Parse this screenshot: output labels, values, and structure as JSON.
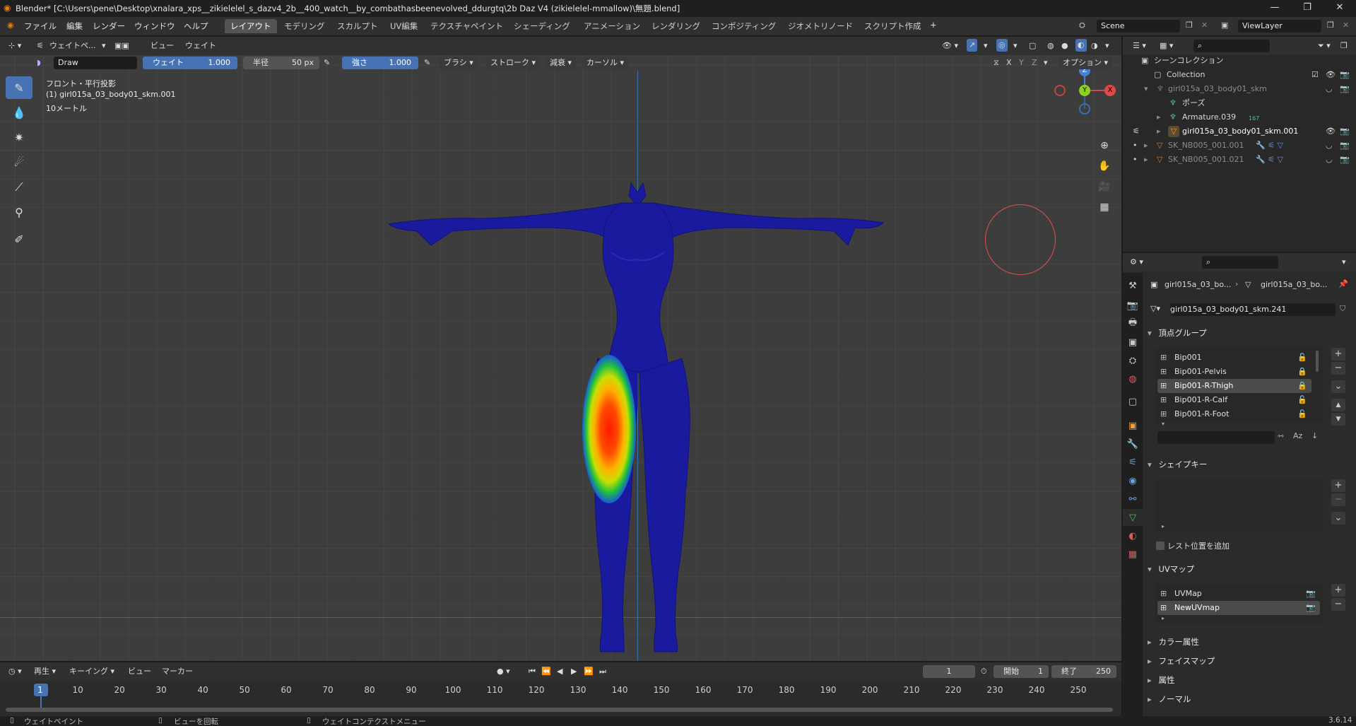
{
  "title_bar": {
    "title": "Blender* [C:\\Users\\pene\\Desktop\\xnalara_xps__zikielelel_s_dazv4_2b__400_watch__by_combathasbeenevolved_ddurgtq\\2b Daz V4 (zikielelel-mmallow)\\無題.blend]"
  },
  "menu": {
    "items": [
      "ファイル",
      "編集",
      "レンダー",
      "ウィンドウ",
      "ヘルプ"
    ],
    "workspaces": [
      "レイアウト",
      "モデリング",
      "スカルプト",
      "UV編集",
      "テクスチャペイント",
      "シェーディング",
      "アニメーション",
      "レンダリング",
      "コンポジティング",
      "ジオメトリノード",
      "スクリプト作成"
    ],
    "add_tab": "+",
    "scene": "Scene",
    "view_layer": "ViewLayer"
  },
  "viewport_header": {
    "mode": "ウェイトペ...",
    "view": "ビュー",
    "weight_menu": "ウェイト"
  },
  "tool_header": {
    "brush_name": "Draw",
    "weight_label": "ウェイト",
    "weight_value": "1.000",
    "radius_label": "半径",
    "radius_value": "50 px",
    "strength_label": "強さ",
    "strength_value": "1.000",
    "brush_menu": "ブラシ",
    "stroke_menu": "ストローク",
    "falloff_menu": "減衰",
    "cursor_menu": "カーソル",
    "axis_x": "X",
    "axis_y": "Y",
    "axis_z": "Z",
    "options": "オプション"
  },
  "viewport_info": {
    "view_name": "フロント・平行投影",
    "object_name": "(1) girl015a_03_body01_skm.001",
    "scale": "10メートル"
  },
  "gizmo": {
    "z": "Z",
    "y": "Y",
    "x": "X"
  },
  "outliner": {
    "root": "シーンコレクション",
    "items": [
      {
        "label": "Collection"
      },
      {
        "label": "girl015a_03_body01_skm"
      },
      {
        "label": "ポーズ"
      },
      {
        "label": "Armature.039",
        "badge": "167"
      },
      {
        "label": "girl015a_03_body01_skm.001"
      },
      {
        "label": "SK_NB005_001.001"
      },
      {
        "label": "SK_NB005_001.021"
      }
    ]
  },
  "properties": {
    "breadcrumb_1": "girl015a_03_bo...",
    "breadcrumb_2": "girl015a_03_bo...",
    "mesh_name": "girl015a_03_body01_skm.241",
    "vertex_groups_title": "頂点グループ",
    "vertex_groups": [
      "Bip001",
      "Bip001-Pelvis",
      "Bip001-R-Thigh",
      "Bip001-R-Calf",
      "Bip001-R-Foot"
    ],
    "selected_group": "Bip001-R-Thigh",
    "shape_keys_title": "シェイプキー",
    "rest_position": "レスト位置を追加",
    "uv_maps_title": "UVマップ",
    "uv_maps": [
      "UVMap",
      "NewUVmap"
    ],
    "color_attr": "カラー属性",
    "face_maps": "フェイスマップ",
    "attributes": "属性",
    "normals": "ノーマル"
  },
  "timeline": {
    "playback": "再生",
    "keying": "キーイング",
    "view": "ビュー",
    "marker": "マーカー",
    "current_frame": "1",
    "start_label": "開始",
    "start_value": "1",
    "end_label": "終了",
    "end_value": "250",
    "ruler": [
      "1",
      "10",
      "20",
      "30",
      "40",
      "50",
      "60",
      "70",
      "80",
      "90",
      "100",
      "110",
      "120",
      "130",
      "140",
      "150",
      "160",
      "170",
      "180",
      "190",
      "200",
      "210",
      "220",
      "230",
      "240",
      "250"
    ]
  },
  "status_bar": {
    "left": "ウェイトペイント",
    "middle": "ビューを回転",
    "right": "ウェイトコンテクストメニュー",
    "version": "3.6.14"
  },
  "colors": {
    "accent": "#4772b3",
    "mesh": "#1a1a9e",
    "brush_circle": "#e0504f"
  }
}
